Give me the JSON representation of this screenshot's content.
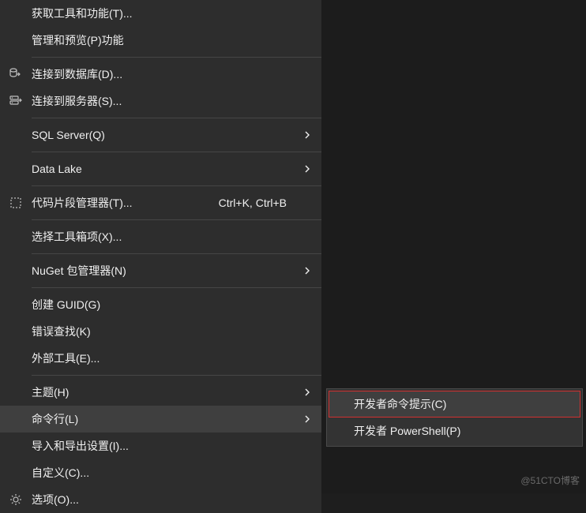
{
  "menu": {
    "items": [
      {
        "label": "获取工具和功能(T)...",
        "has_submenu": false,
        "icon": null,
        "shortcut": ""
      },
      {
        "label": "管理和预览(P)功能",
        "has_submenu": false,
        "icon": null,
        "shortcut": ""
      },
      {
        "sep": true
      },
      {
        "label": "连接到数据库(D)...",
        "has_submenu": false,
        "icon": "db",
        "shortcut": ""
      },
      {
        "label": "连接到服务器(S)...",
        "has_submenu": false,
        "icon": "server",
        "shortcut": ""
      },
      {
        "sep": true
      },
      {
        "label": "SQL Server(Q)",
        "has_submenu": true,
        "icon": null,
        "shortcut": ""
      },
      {
        "sep": true
      },
      {
        "label": "Data Lake",
        "has_submenu": true,
        "icon": null,
        "shortcut": ""
      },
      {
        "sep": true
      },
      {
        "label": "代码片段管理器(T)...",
        "has_submenu": false,
        "icon": "snippet",
        "shortcut": "Ctrl+K, Ctrl+B"
      },
      {
        "sep": true
      },
      {
        "label": "选择工具箱项(X)...",
        "has_submenu": false,
        "icon": null,
        "shortcut": ""
      },
      {
        "sep": true
      },
      {
        "label": "NuGet 包管理器(N)",
        "has_submenu": true,
        "icon": null,
        "shortcut": ""
      },
      {
        "sep": true
      },
      {
        "label": "创建 GUID(G)",
        "has_submenu": false,
        "icon": null,
        "shortcut": ""
      },
      {
        "label": "错误查找(K)",
        "has_submenu": false,
        "icon": null,
        "shortcut": ""
      },
      {
        "label": "外部工具(E)...",
        "has_submenu": false,
        "icon": null,
        "shortcut": ""
      },
      {
        "sep": true
      },
      {
        "label": "主题(H)",
        "has_submenu": true,
        "icon": null,
        "shortcut": ""
      },
      {
        "label": "命令行(L)",
        "has_submenu": true,
        "icon": null,
        "shortcut": "",
        "highlighted": true
      },
      {
        "label": "导入和导出设置(I)...",
        "has_submenu": false,
        "icon": null,
        "shortcut": ""
      },
      {
        "label": "自定义(C)...",
        "has_submenu": false,
        "icon": null,
        "shortcut": ""
      },
      {
        "label": "选项(O)...",
        "has_submenu": false,
        "icon": "gear",
        "shortcut": ""
      }
    ]
  },
  "submenu": {
    "items": [
      {
        "label": "开发者命令提示(C)",
        "highlighted": true
      },
      {
        "label": "开发者 PowerShell(P)",
        "highlighted": false
      }
    ]
  },
  "watermark": "@51CTO博客"
}
